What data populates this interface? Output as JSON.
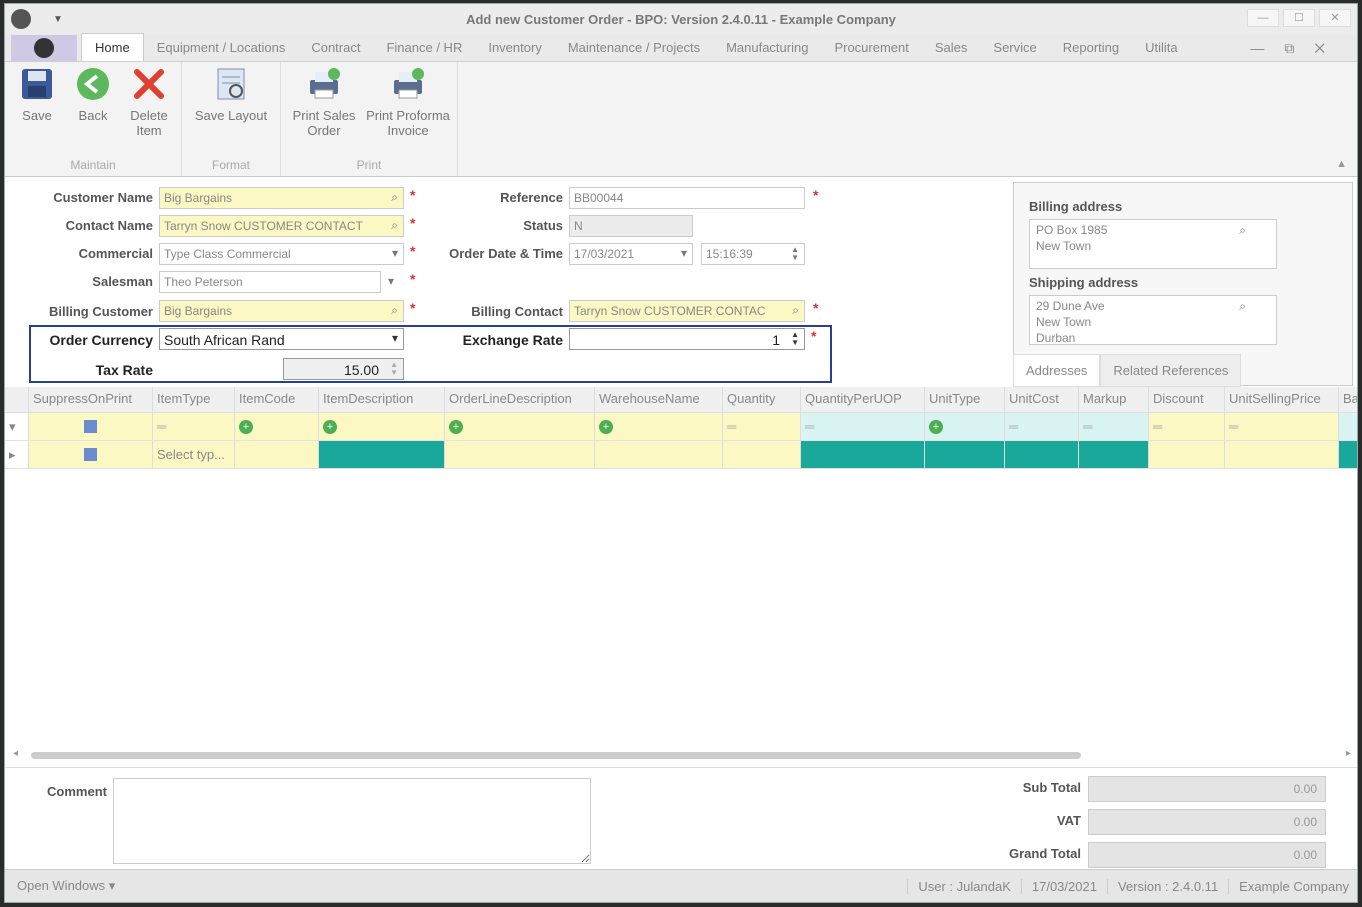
{
  "window": {
    "title": "Add new Customer Order - BPO: Version 2.4.0.11 - Example Company"
  },
  "menu": {
    "tabs": [
      "Home",
      "Equipment / Locations",
      "Contract",
      "Finance / HR",
      "Inventory",
      "Maintenance / Projects",
      "Manufacturing",
      "Procurement",
      "Sales",
      "Service",
      "Reporting",
      "Utilita"
    ]
  },
  "ribbon": {
    "maintain": {
      "label": "Maintain",
      "save": "Save",
      "back": "Back",
      "delete_l1": "Delete",
      "delete_l2": "Item"
    },
    "format": {
      "label": "Format",
      "save_layout": "Save Layout"
    },
    "print": {
      "label": "Print",
      "sales_l1": "Print Sales",
      "sales_l2": "Order",
      "proforma_l1": "Print Proforma",
      "proforma_l2": "Invoice"
    }
  },
  "form": {
    "customer_name": {
      "label": "Customer Name",
      "value": "Big Bargains"
    },
    "contact_name": {
      "label": "Contact Name",
      "value": "Tarryn Snow CUSTOMER CONTACT"
    },
    "commercial": {
      "label": "Commercial",
      "value": "Type Class Commercial"
    },
    "salesman": {
      "label": "Salesman",
      "value": "Theo Peterson"
    },
    "billing_customer": {
      "label": "Billing Customer",
      "value": "Big Bargains"
    },
    "reference": {
      "label": "Reference",
      "value": "BB00044"
    },
    "status": {
      "label": "Status",
      "value": "N"
    },
    "order_date": {
      "label": "Order Date & Time",
      "date": "17/03/2021",
      "time": "15:16:39"
    },
    "billing_contact": {
      "label": "Billing Contact",
      "value": "Tarryn Snow CUSTOMER CONTAC"
    },
    "order_currency": {
      "label": "Order Currency",
      "value": "South African Rand"
    },
    "exchange_rate": {
      "label": "Exchange Rate",
      "value": "1"
    },
    "tax_rate": {
      "label": "Tax Rate",
      "value": "15.00"
    }
  },
  "addresses": {
    "billing_label": "Billing address",
    "billing_l1": "PO Box 1985",
    "billing_l2": "New Town",
    "shipping_label": "Shipping address",
    "shipping_l1": "29 Dune Ave",
    "shipping_l2": "New Town",
    "shipping_l3": "Durban",
    "tab_addresses": "Addresses",
    "tab_related": "Related References"
  },
  "grid": {
    "columns": [
      "SuppressOnPrint",
      "ItemType",
      "ItemCode",
      "ItemDescription",
      "OrderLineDescription",
      "WarehouseName",
      "Quantity",
      "QuantityPerUOP",
      "UnitType",
      "UnitCost",
      "Markup",
      "Discount",
      "UnitSellingPrice",
      "Ba"
    ],
    "new_row_itemtype": "Select typ..."
  },
  "bottom": {
    "comment_label": "Comment",
    "sub_total_label": "Sub Total",
    "sub_total": "0.00",
    "vat_label": "VAT",
    "vat": "0.00",
    "grand_total_label": "Grand Total",
    "grand_total": "0.00"
  },
  "status": {
    "open_windows": "Open Windows ▾",
    "user": "User : JulandaK",
    "date": "17/03/2021",
    "version": "Version : 2.4.0.11",
    "company": "Example Company"
  },
  "colors": {
    "accent_box": "#2a3f8f",
    "teal": "#1aa89a",
    "required": "#d33333",
    "field_yellow": "#fbf8c4"
  }
}
